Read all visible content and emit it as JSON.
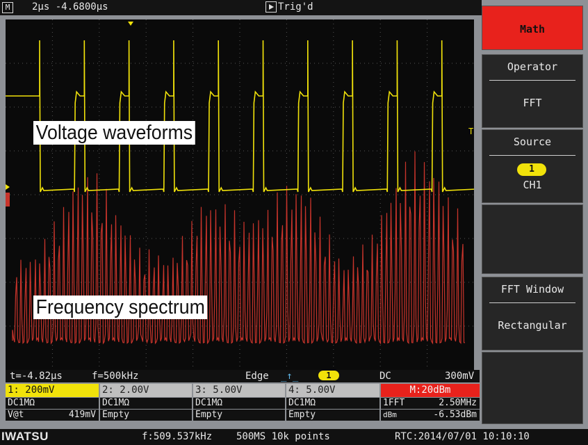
{
  "top_bar": {
    "mode_icon": "M",
    "timebase": "2µs -4.6800µs",
    "trigger_status": "Trig'd"
  },
  "labels": {
    "voltage": "Voltage waveforms",
    "frequency": "Frequency spectrum"
  },
  "status_line": {
    "cursor_time": "t=-4.82µs",
    "frequency": "f=500kHz",
    "trigger_type": "Edge",
    "trigger_source": "1",
    "coupling": "DC",
    "trigger_level": "300mV"
  },
  "channels": [
    {
      "scale": "1: 200mV",
      "coupling": "DC1MΩ",
      "measure_label": "V@t",
      "measure_value": "419mV",
      "color": "#f1e20a"
    },
    {
      "scale": "2: 2.00V",
      "coupling": "DC1MΩ",
      "measure_label": "Empty",
      "measure_value": "",
      "color": "#bfbfbf"
    },
    {
      "scale": "3: 5.00V",
      "coupling": "DC1MΩ",
      "measure_label": "Empty",
      "measure_value": "",
      "color": "#bfbfbf"
    },
    {
      "scale": "4: 5.00V",
      "coupling": "DC1MΩ",
      "measure_label": "Empty",
      "measure_value": "",
      "color": "#bfbfbf"
    }
  ],
  "math_info": {
    "scale": "M:20dBm",
    "function": "1FFT",
    "center_freq": "2.50MHz",
    "unit": "dBm",
    "level": "-6.53dBm",
    "color": "#e8221c"
  },
  "bottom_bar": {
    "brand": "IWATSU",
    "measured_freq": "f:509.537kHz",
    "sample_info": "500MS 10k points",
    "rtc": "RTC:2014/07/01 10:10:10"
  },
  "menu": {
    "math": "Math",
    "operator_title": "Operator",
    "operator_value": "FFT",
    "source_title": "Source",
    "source_channel": "1",
    "source_value": "CH1",
    "fft_window_title": "FFT Window",
    "fft_window_value": "Rectangular"
  },
  "markers": {
    "trigger_level_marker": "T"
  },
  "colors": {
    "ch1": "#f1e20a",
    "math": "#c8342b",
    "accent": "#e8221c"
  }
}
